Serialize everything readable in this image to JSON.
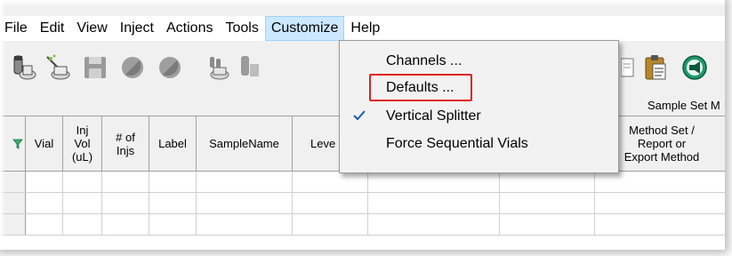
{
  "menubar": {
    "items": [
      {
        "label": "File"
      },
      {
        "label": "Edit"
      },
      {
        "label": "View"
      },
      {
        "label": "Inject"
      },
      {
        "label": "Actions"
      },
      {
        "label": "Tools"
      },
      {
        "label": "Customize"
      },
      {
        "label": "Help"
      }
    ],
    "active": "Customize"
  },
  "toolbar": {
    "buttons": [
      "vial-load-icon",
      "vial-wand-icon",
      "save-icon",
      "stop-circle-icon",
      "stop-circle-icon",
      "vials-icon",
      "vial-tube-icon",
      "clipboard-icon",
      "clipboard-paste-icon",
      "megaphone-icon"
    ]
  },
  "dropdown": {
    "items": [
      {
        "label": "Channels ...",
        "checked": false
      },
      {
        "label": "Defaults ...",
        "checked": false,
        "highlighted": true
      },
      {
        "label": "Vertical Splitter",
        "checked": true
      },
      {
        "label": "Force Sequential Vials",
        "checked": false
      }
    ],
    "highlight_color": "#e02020"
  },
  "table": {
    "section_title": "Sample Set M",
    "columns": {
      "vial": "Vial",
      "inj_vol_1": "Inj",
      "inj_vol_2": "Vol",
      "inj_vol_3": "(uL)",
      "num_injs_1": "# of",
      "num_injs_2": "Injs",
      "label": "Label",
      "sample_name": "SampleName",
      "level": "Leve",
      "method_set_1": "Method Set /",
      "method_set_2": "Report or",
      "method_set_3": "Export Method"
    }
  },
  "colors": {
    "menu_active_bg": "#cce8ff",
    "menu_active_border": "#99d1ff",
    "toolbar_bg": "#f0f0f0"
  }
}
